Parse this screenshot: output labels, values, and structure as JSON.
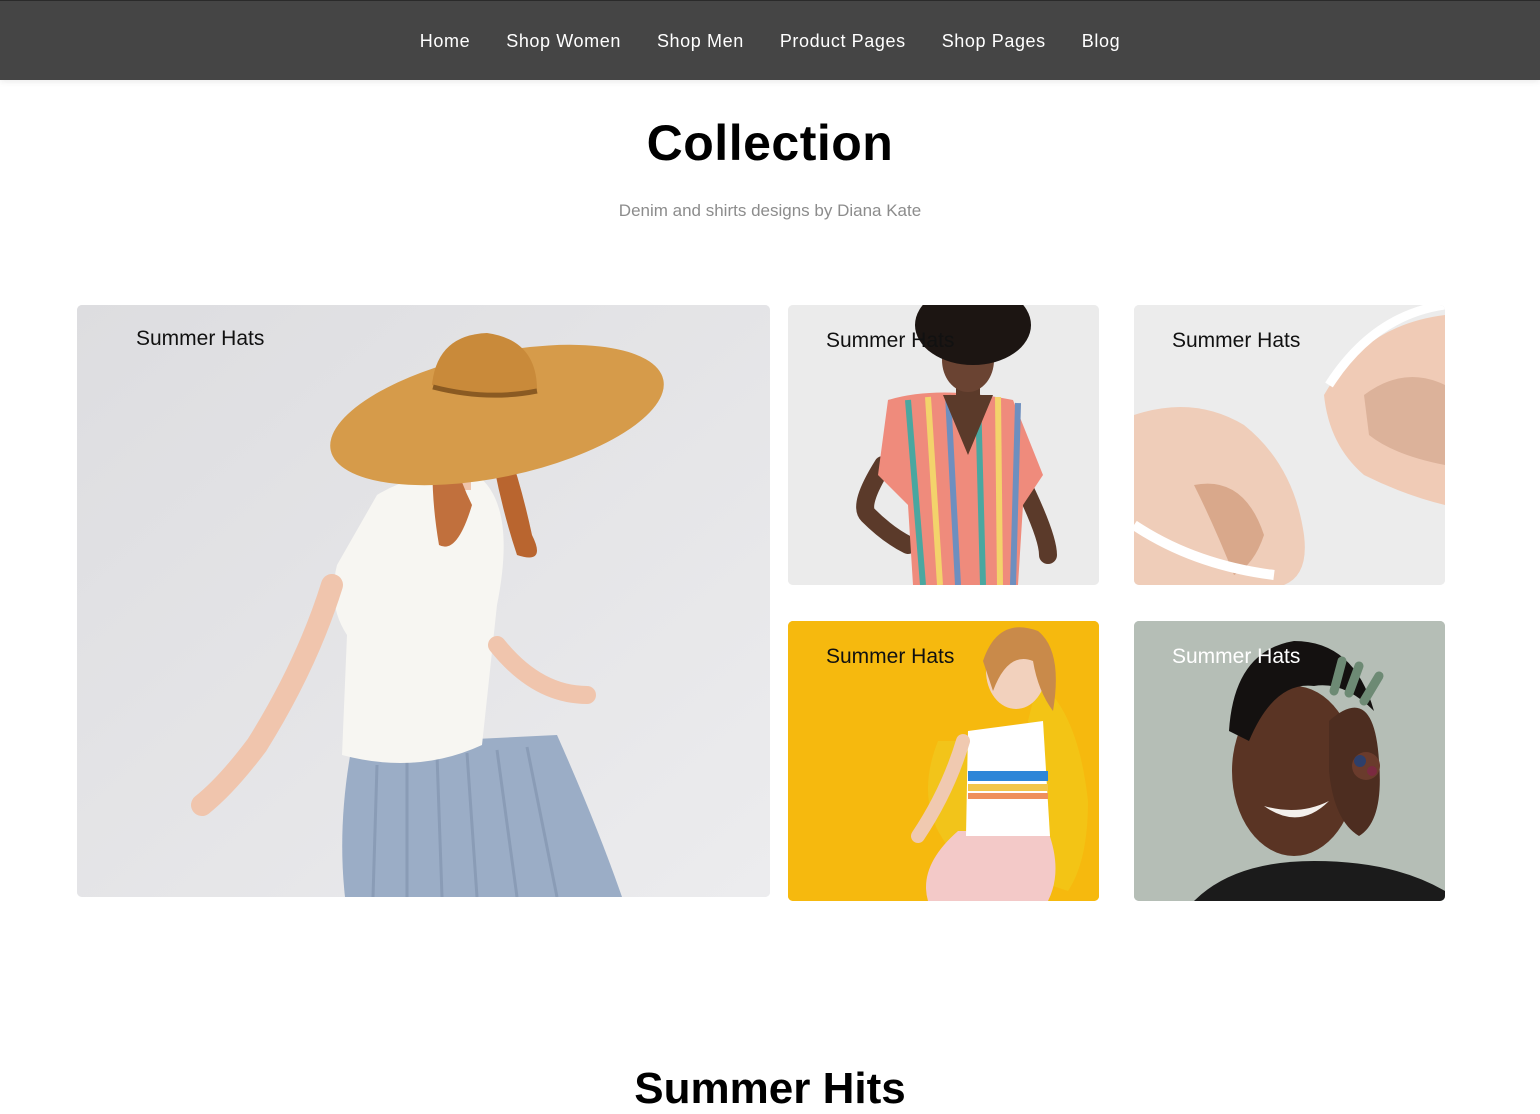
{
  "nav": {
    "items": [
      {
        "label": "Home"
      },
      {
        "label": "Shop Women"
      },
      {
        "label": "Shop Men"
      },
      {
        "label": "Product Pages"
      },
      {
        "label": "Shop Pages"
      },
      {
        "label": "Blog"
      }
    ]
  },
  "collection": {
    "title": "Collection",
    "subtitle": "Denim and shirts designs by Diana Kate",
    "cards": [
      {
        "label": "Summer Hats"
      },
      {
        "label": "Summer Hats"
      },
      {
        "label": "Summer Hats"
      },
      {
        "label": "Summer Hats"
      },
      {
        "label": "Summer Hats"
      }
    ]
  },
  "next_section": {
    "title": "Summer Hits"
  },
  "colors": {
    "nav_bg": "#454545",
    "subtitle": "#8c8c8c",
    "yellow_card": "#f6b90e",
    "sage_card": "#b3bcb4"
  }
}
